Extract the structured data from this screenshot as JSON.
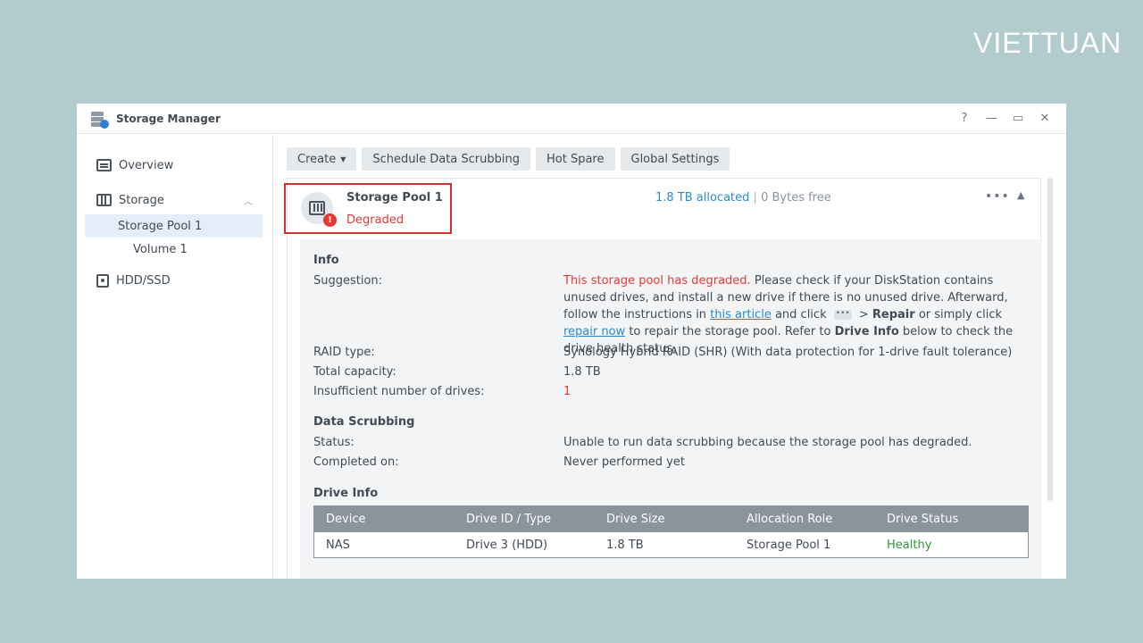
{
  "brand": "VIETTUAN",
  "window": {
    "title": "Storage Manager",
    "controls": [
      "?",
      "—",
      "▭",
      "✕"
    ]
  },
  "sidebar": {
    "items": [
      {
        "label": "Overview",
        "icon": "overview-icon"
      },
      {
        "label": "Storage",
        "icon": "storage-icon",
        "expanded": true
      },
      {
        "label": "HDD/SSD",
        "icon": "hdd-icon"
      }
    ],
    "storage_children": [
      {
        "label": "Storage Pool 1",
        "selected": true
      },
      {
        "label": "Volume 1"
      }
    ]
  },
  "toolbar": {
    "create": "Create",
    "scrub": "Schedule Data Scrubbing",
    "hot_spare": "Hot Spare",
    "global_settings": "Global Settings"
  },
  "pool": {
    "name": "Storage Pool 1",
    "status": "Degraded",
    "allocated": "1.8 TB allocated",
    "separator": "|",
    "free": "0 Bytes free"
  },
  "info": {
    "title": "Info",
    "suggestion_label": "Suggestion:",
    "suggestion_red": "This storage pool has degraded.",
    "suggestion_1": " Please check if your DiskStation contains unused drives, and install a new drive if there is no unused drive. Afterward, follow the instructions in ",
    "suggestion_link1": "this article",
    "suggestion_2": " and click ",
    "suggestion_dots": "•••",
    "suggestion_3": " > ",
    "suggestion_repair": "Repair",
    "suggestion_4": " or simply click ",
    "suggestion_link2": "repair now",
    "suggestion_5": " to repair the storage pool. Refer to ",
    "suggestion_driveinfo": "Drive Info",
    "suggestion_6": " below to check the drive health status.",
    "raid_label": "RAID type:",
    "raid_value": "Synology Hybrid RAID (SHR) (With data protection for 1-drive fault tolerance)",
    "capacity_label": "Total capacity:",
    "capacity_value": "1.8 TB",
    "insufficient_label": "Insufficient number of drives:",
    "insufficient_value": "1"
  },
  "scrubbing": {
    "title": "Data Scrubbing",
    "status_label": "Status:",
    "status_value": "Unable to run data scrubbing because the storage pool has degraded.",
    "completed_label": "Completed on:",
    "completed_value": "Never performed yet"
  },
  "drive_info": {
    "title": "Drive Info",
    "columns": [
      "Device",
      "Drive ID / Type",
      "Drive Size",
      "Allocation Role",
      "Drive Status"
    ],
    "rows": [
      [
        "NAS",
        "Drive 3 (HDD)",
        "1.8 TB",
        "Storage Pool 1",
        "Healthy"
      ]
    ]
  },
  "colors": {
    "background": "#b2cccd",
    "accent": "#2c8ad0",
    "error": "#e53935",
    "highlight_box": "#d32f2f",
    "healthy": "#2e9a3a"
  }
}
